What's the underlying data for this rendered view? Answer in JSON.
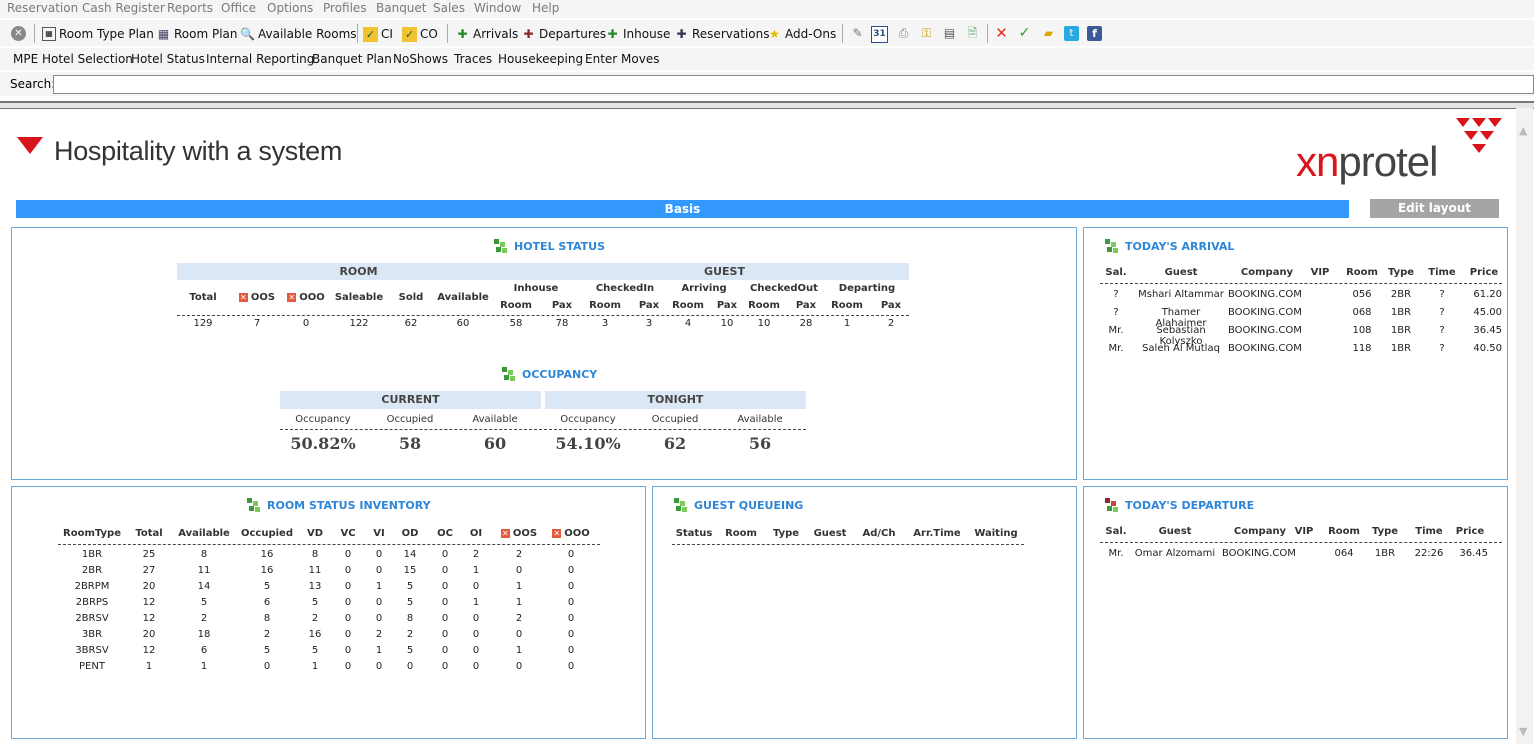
{
  "menu": [
    "Reservation",
    "Cash Register",
    "Reports",
    "Office",
    "Options",
    "Profiles",
    "Banquet",
    "Sales",
    "Window",
    "Help"
  ],
  "toolbar": {
    "room_type_plan": "Room Type Plan",
    "room_plan": "Room Plan",
    "available_rooms": "Available Rooms",
    "ci": "CI",
    "co": "CO",
    "arrivals": "Arrivals",
    "departures": "Departures",
    "inhouse": "Inhouse",
    "reservations": "Reservations",
    "add_ons": "Add-Ons",
    "calendar_day": "31"
  },
  "linkbar": [
    "MPE Hotel Selection",
    "Hotel Status",
    "Internal Reporting",
    "Banquet Plan",
    "NoShows",
    "Traces",
    "Housekeeping",
    "Enter Moves"
  ],
  "search": {
    "label": "Search:",
    "value": ""
  },
  "header": {
    "tagline": "Hospitality with a system",
    "logo_xn": "xn",
    "logo_protel": "protel"
  },
  "basis": {
    "label": "Basis",
    "edit_layout": "Edit layout"
  },
  "hotel_status": {
    "title": "HOTEL STATUS",
    "room_band": "ROOM",
    "guest_band": "GUEST",
    "room_cols": [
      "Total",
      "OOS",
      "OOO",
      "Saleable",
      "Sold",
      "Available"
    ],
    "guest_groups": [
      "Inhouse",
      "CheckedIn",
      "Arriving",
      "CheckedOut",
      "Departing"
    ],
    "guest_sub": [
      "Room",
      "Pax"
    ],
    "values": [
      "129",
      "7",
      "0",
      "122",
      "62",
      "60",
      "58",
      "78",
      "3",
      "3",
      "4",
      "10",
      "10",
      "28",
      "1",
      "2"
    ]
  },
  "occupancy": {
    "title": "OCCUPANCY",
    "current_band": "CURRENT",
    "tonight_band": "TONIGHT",
    "cols": [
      "Occupancy",
      "Occupied",
      "Available"
    ],
    "current": [
      "50.82%",
      "58",
      "60"
    ],
    "tonight": [
      "54.10%",
      "62",
      "56"
    ]
  },
  "arrival": {
    "title": "TODAY'S ARRIVAL",
    "cols": [
      "Sal.",
      "Guest",
      "Company",
      "VIP",
      "Room",
      "Type",
      "Time",
      "Price"
    ],
    "rows": [
      [
        "?",
        "Mshari Altammar",
        "BOOKING.COM",
        "",
        "056",
        "2BR",
        "?",
        "61.20"
      ],
      [
        "?",
        "Thamer Alahaimer",
        "BOOKING.COM",
        "",
        "068",
        "1BR",
        "?",
        "45.00"
      ],
      [
        "Mr.",
        "Sebastian Kolyszko",
        "BOOKING.COM",
        "",
        "108",
        "1BR",
        "?",
        "36.45"
      ],
      [
        "Mr.",
        "Saleh Al Mutlaq",
        "BOOKING.COM",
        "",
        "118",
        "1BR",
        "?",
        "40.50"
      ]
    ]
  },
  "inventory": {
    "title": "ROOM STATUS INVENTORY",
    "cols": [
      "RoomType",
      "Total",
      "Available",
      "Occupied",
      "VD",
      "VC",
      "VI",
      "OD",
      "OC",
      "OI",
      "OOS",
      "OOO"
    ],
    "rows": [
      [
        "1BR",
        "25",
        "8",
        "16",
        "8",
        "0",
        "0",
        "14",
        "0",
        "2",
        "2",
        "0"
      ],
      [
        "2BR",
        "27",
        "11",
        "16",
        "11",
        "0",
        "0",
        "15",
        "0",
        "1",
        "0",
        "0"
      ],
      [
        "2BRPM",
        "20",
        "14",
        "5",
        "13",
        "0",
        "1",
        "5",
        "0",
        "0",
        "1",
        "0"
      ],
      [
        "2BRPS",
        "12",
        "5",
        "6",
        "5",
        "0",
        "0",
        "5",
        "0",
        "1",
        "1",
        "0"
      ],
      [
        "2BRSV",
        "12",
        "2",
        "8",
        "2",
        "0",
        "0",
        "8",
        "0",
        "0",
        "2",
        "0"
      ],
      [
        "3BR",
        "20",
        "18",
        "2",
        "16",
        "0",
        "2",
        "2",
        "0",
        "0",
        "0",
        "0"
      ],
      [
        "3BRSV",
        "12",
        "6",
        "5",
        "5",
        "0",
        "1",
        "5",
        "0",
        "0",
        "1",
        "0"
      ],
      [
        "PENT",
        "1",
        "1",
        "0",
        "1",
        "0",
        "0",
        "0",
        "0",
        "0",
        "0",
        "0"
      ]
    ]
  },
  "queue": {
    "title": "GUEST QUEUEING",
    "cols": [
      "Status",
      "Room",
      "Type",
      "Guest",
      "Ad/Ch",
      "Arr.Time",
      "Waiting"
    ]
  },
  "departure": {
    "title": "TODAY'S DEPARTURE",
    "cols": [
      "Sal.",
      "Guest",
      "Company",
      "VIP",
      "Room",
      "Type",
      "Time",
      "Price"
    ],
    "rows": [
      [
        "Mr.",
        "Omar Alzomami",
        "BOOKING.COM",
        "",
        "064",
        "1BR",
        "22:26",
        "36.45"
      ]
    ]
  },
  "colors": {
    "accent": "#3399ff",
    "brand_red": "#d9141b",
    "panel_border": "#6aa9d8",
    "title_blue": "#2e86d6"
  }
}
